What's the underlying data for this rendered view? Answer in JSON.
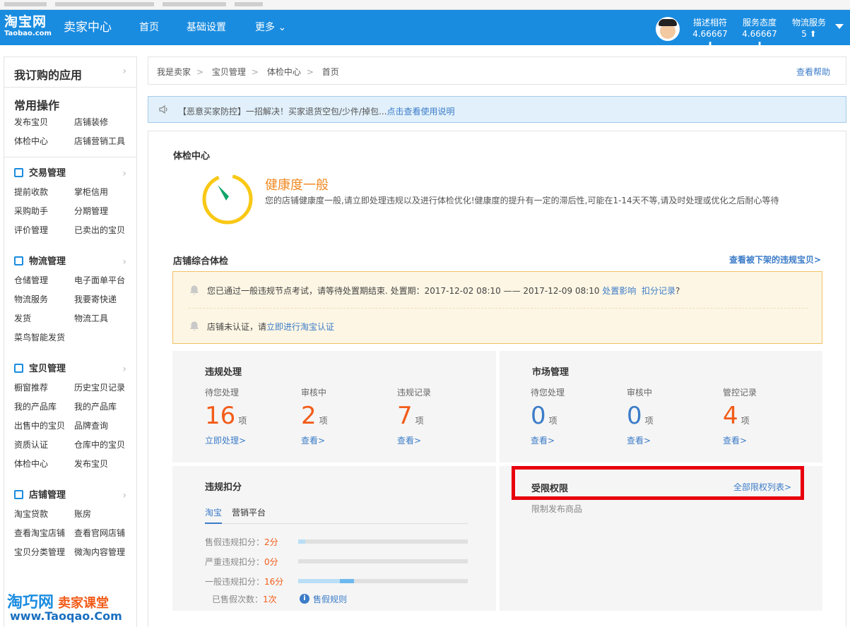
{
  "header": {
    "logo_cn": "淘宝网",
    "logo_en": "Taobao.com",
    "center_title": "卖家中心",
    "nav": [
      "首页",
      "基础设置",
      "更多 ⌄"
    ],
    "scores": [
      {
        "label": "描述相符",
        "value": "4.66667 ⬇"
      },
      {
        "label": "服务态度",
        "value": "4.66667 ⬇"
      },
      {
        "label": "物流服务",
        "value": "5 ⬆"
      }
    ]
  },
  "sidebar": {
    "apps_title": "我订购的应用",
    "common_title": "常用操作",
    "common_items": [
      "发布宝贝",
      "店铺装修",
      "体检中心",
      "店铺营销工具"
    ],
    "sections": [
      {
        "title": "交易管理",
        "items": [
          "提前收款",
          "掌柜信用",
          "采购助手",
          "分期管理",
          "评价管理",
          "已卖出的宝贝"
        ]
      },
      {
        "title": "物流管理",
        "items": [
          "仓储管理",
          "电子面单平台",
          "物流服务",
          "我要寄快递",
          "发货",
          "物流工具",
          "菜鸟智能发货"
        ]
      },
      {
        "title": "宝贝管理",
        "items": [
          "橱窗推荐",
          "历史宝贝记录",
          "我的产品库",
          "我的产品库",
          "出售中的宝贝",
          "品牌查询",
          "资质认证",
          "仓库中的宝贝",
          "体检中心",
          "发布宝贝"
        ]
      },
      {
        "title": "店铺管理",
        "items": [
          "淘宝贷款",
          "账房",
          "查看淘宝店铺",
          "查看官网店铺",
          "宝贝分类管理",
          "微淘内容管理"
        ]
      }
    ],
    "chevron": "›"
  },
  "breadcrumb": {
    "items": [
      "我是卖家",
      "宝贝管理",
      "体检中心",
      "首页"
    ],
    "sep": ">",
    "help": "查看帮助"
  },
  "notice": {
    "text": "【恶意买家防控】一招解决！买家退货空包/少件/掉包...",
    "link": "点击查看使用说明"
  },
  "health": {
    "section_title": "体检中心",
    "status": "健康度一般",
    "desc": "您的店铺健康度一般,请立即处理违规以及进行体检优化!健康度的提升有一定的滞后性,可能在1-14天不等,请及时处理或优化之后耐心等待"
  },
  "overall": {
    "title": "店铺综合体检",
    "link": "查看被下架的违规宝贝>"
  },
  "alerts": {
    "row1_text": "您已通过一般违规节点考试，请等待处置期结束. 处置期：2017-12-02 08:10 —— 2017-12-09 08:10",
    "row1_link1": "处置影响",
    "row1_link2": "扣分记录",
    "row1_tail": "?",
    "row2_text": "店铺未认证，请",
    "row2_link": "立即进行淘宝认证"
  },
  "violation": {
    "title": "违规处理",
    "unit": "项",
    "stats": [
      {
        "label": "待您处理",
        "value": "16",
        "action": "立即处理>"
      },
      {
        "label": "审核中",
        "value": "2",
        "action": "查看>"
      },
      {
        "label": "违规记录",
        "value": "7",
        "action": "查看>"
      }
    ]
  },
  "market": {
    "title": "市场管理",
    "unit": "项",
    "stats": [
      {
        "label": "待您处理",
        "value": "0",
        "action": "查看>"
      },
      {
        "label": "审核中",
        "value": "0",
        "action": "查看>"
      },
      {
        "label": "管控记录",
        "value": "4",
        "action": "查看>"
      }
    ]
  },
  "deduct": {
    "title": "违规扣分",
    "tabs": [
      "淘宝",
      "营销平台"
    ],
    "rows": [
      {
        "label": "售假违规扣分：",
        "score": "2分",
        "level": 0.04
      },
      {
        "label": "严重违规扣分：",
        "score": "0分",
        "level": 0
      },
      {
        "label": "一般违规扣分：",
        "score": "16分",
        "level": 0.33
      }
    ],
    "sold_label": "已售假次数：",
    "sold_value": "1次",
    "info_icon": "i",
    "rule_link": "售假规则"
  },
  "restrict": {
    "title": "受限权限",
    "link": "全部限权列表>",
    "item": "限制发布商品"
  },
  "watermark": {
    "line1": "淘巧网",
    "line1b": "卖家课堂",
    "line2": "www.Taoqao.Com"
  },
  "colors": {
    "brand": "#1a8ce0",
    "accent_orange": "#f25c19",
    "link": "#3c7cc8",
    "zero_blue": "#3c7cc8",
    "highlight": "#e8000d"
  }
}
